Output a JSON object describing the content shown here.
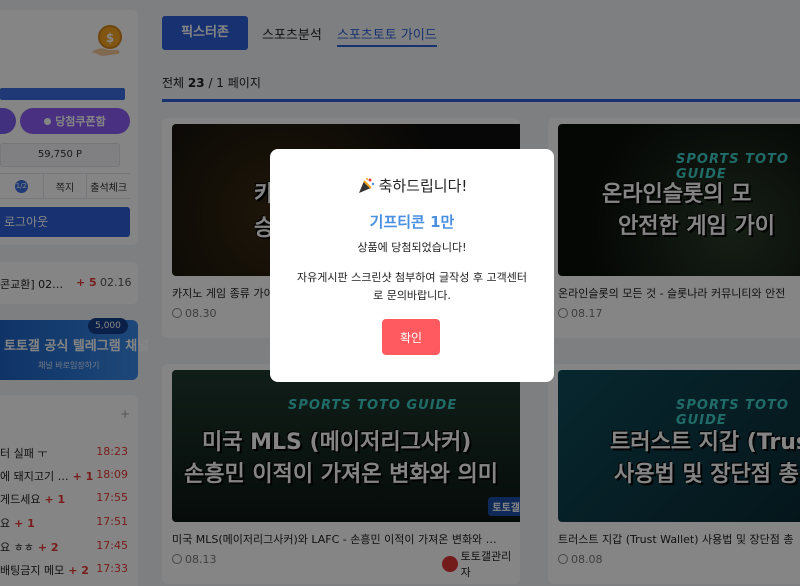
{
  "sidebar": {
    "coupon_button": "당첨쿠폰함",
    "points": "59,750 P",
    "mini_badge": "1/2",
    "mini_links": [
      "쪽지",
      "출석체크"
    ],
    "logout_button": "로그아웃",
    "notice": {
      "text": "콘교환] 02…",
      "count": "+ 5",
      "date": "02.16"
    },
    "telegram_banner": {
      "badge": "5,000",
      "title": "토토갤 공식 텔레그램 채널",
      "sub": "채널 바로입장하기"
    },
    "recent_list": [
      {
        "text": "터 실패 ㅜ",
        "count": "",
        "time": "18:23"
      },
      {
        "text": "에 돼지고기 …",
        "count": "+ 1",
        "time": "18:09"
      },
      {
        "text": "게드세요",
        "count": "+ 1",
        "time": "17:55"
      },
      {
        "text": "요",
        "count": "+ 1",
        "time": "17:51"
      },
      {
        "text": "요 ㅎㅎ",
        "count": "+ 2",
        "time": "17:45"
      },
      {
        "text": " 배팅금지 메모",
        "count": "+ 2",
        "time": "17:33"
      }
    ]
  },
  "tabs": {
    "active": "픽스터존",
    "analysis": "스포츠분석",
    "guide": "스포츠토토 가이드"
  },
  "listing": {
    "label": "전체",
    "total": "23",
    "pages": "/ 1 페이지"
  },
  "cards": [
    {
      "overlay_top": "카",
      "overlay_bottom": "승",
      "title": "카지노 게임 종류 가이",
      "date": "08.30"
    },
    {
      "sg_label": "SPORTS TOTO GUIDE",
      "overlay_top": "온라인슬롯의 모",
      "overlay_bottom": "안전한 게임 가이",
      "title": "온라인슬롯의 모든 것 - 슬롯나라 커뮤니티와 안전",
      "date": "08.17"
    },
    {
      "sg_label": "SPORTS TOTO GUIDE",
      "overlay_top": "미국 MLS (메이저리그사커)",
      "overlay_bottom": "손흥민 이적이 가져온 변화와 의미",
      "title": "미국 MLS(메이저리그사커)와 LAFC - 손흥민 이적이 가져온 변화와 …",
      "date": "08.13",
      "author": "토토갤관리자",
      "logo": "토토갤"
    },
    {
      "sg_label": "SPORTS TOTO GUIDE",
      "overlay_top": "트러스트 지갑 (Trus",
      "overlay_bottom": "사용법 및 장단점 총",
      "title": "트러스트 지갑 (Trust Wallet) 사용법 및 장단점 총",
      "date": "08.08"
    }
  ],
  "modal": {
    "title": "축하드립니다!",
    "prize": "기프티콘 1만",
    "won": "상품에 당첨되었습니다!",
    "message": "자유게시판 스크린샷 첨부하여 글작성 후 고객센터로 문의바랍니다.",
    "confirm_button": "확인"
  },
  "colors": {
    "primary": "#2f5fd8",
    "coupon": "#8c5cf5",
    "confirm": "#ff5a5f",
    "prize": "#4a90e2",
    "accent_red": "#e53935"
  }
}
